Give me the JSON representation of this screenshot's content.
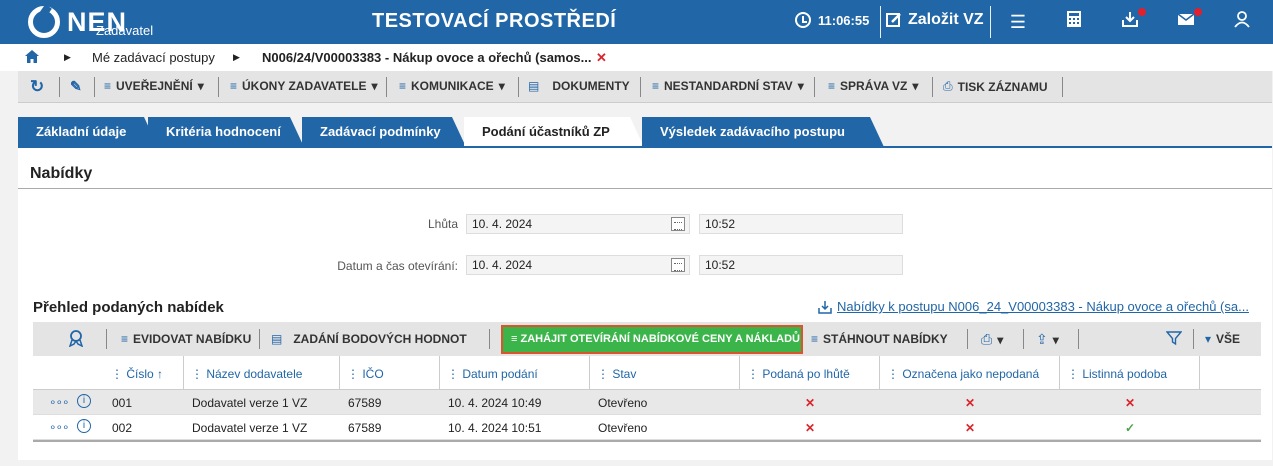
{
  "header": {
    "logo": "NEN",
    "logo_sub": "Zadavatel",
    "env_title": "TESTOVACÍ PROSTŘEDÍ",
    "time": "11:06:55",
    "create_label": "Založit VZ"
  },
  "breadcrumb": {
    "item1": "Mé zadávací postupy",
    "item2": "N006/24/V00003383 - Nákup ovoce a ořechů (samos..."
  },
  "toolbar": {
    "uverejneni": "UVEŘEJNĚNÍ",
    "ukony": "ÚKONY ZADAVATELE",
    "komunikace": "KOMUNIKACE",
    "dokumenty": "DOKUMENTY",
    "nestandardni": "NESTANDARDNÍ STAV",
    "sprava": "SPRÁVA VZ",
    "tisk": "TISK ZÁZNAMU"
  },
  "tabs": {
    "t1": "Základní údaje",
    "t2": "Kritéria hodnocení",
    "t3": "Zadávací podmínky",
    "t4": "Podání účastníků ZP",
    "t5": "Výsledek zadávacího postupu"
  },
  "panel": {
    "title": "Nabídky",
    "lhuta_label": "Lhůta",
    "lhuta_date": "10. 4. 2024",
    "lhuta_time": "10:52",
    "otevirani_label": "Datum a čas otevírání:",
    "otevirani_date": "10. 4. 2024",
    "otevirani_time": "10:52",
    "section_title": "Přehled podaných nabídek",
    "link": "Nabídky k postupu N006_24_V00003383 - Nákup ovoce a ořechů (sa..."
  },
  "gridbar": {
    "evidovat": "EVIDOVAT NABÍDKU",
    "zadani": "ZADÁNÍ BODOVÝCH HODNOT",
    "zahajit": "ZAHÁJIT OTEVÍRÁNÍ NABÍDKOVÉ CENY A NÁKLADŮ",
    "stahnout": "STÁHNOUT NABÍDKY",
    "vse": "VŠE"
  },
  "table": {
    "headers": {
      "cislo": "Číslo ↑",
      "nazev": "Název dodavatele",
      "ico": "IČO",
      "datum": "Datum podání",
      "stav": "Stav",
      "podana": "Podaná po lhůtě",
      "oznacena": "Označena jako nepodaná",
      "listinna": "Listinná podoba"
    },
    "rows": [
      {
        "cislo": "001",
        "nazev": "Dodavatel verze 1 VZ",
        "ico": "67589",
        "datum": "10. 4. 2024 10:49",
        "stav": "Otevřeno",
        "podana": "✕",
        "oznacena": "✕",
        "listinna": "✕"
      },
      {
        "cislo": "002",
        "nazev": "Dodavatel verze 1 VZ",
        "ico": "67589",
        "datum": "10. 4. 2024 10:51",
        "stav": "Otevřeno",
        "podana": "✕",
        "oznacena": "✕",
        "listinna": "✓"
      }
    ]
  }
}
